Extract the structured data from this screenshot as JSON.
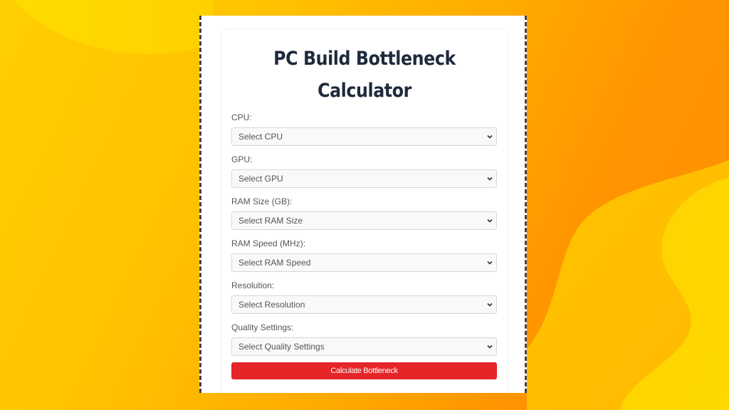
{
  "page": {
    "title": "PC Build Bottleneck Calculator"
  },
  "form": {
    "fields": [
      {
        "label": "CPU:",
        "placeholder": "Select CPU"
      },
      {
        "label": "GPU:",
        "placeholder": "Select GPU"
      },
      {
        "label": "RAM Size (GB):",
        "placeholder": "Select RAM Size"
      },
      {
        "label": "RAM Speed (MHz):",
        "placeholder": "Select RAM Speed"
      },
      {
        "label": "Resolution:",
        "placeholder": "Select Resolution"
      },
      {
        "label": "Quality Settings:",
        "placeholder": "Select Quality Settings"
      }
    ],
    "submit_label": "Calculate Bottleneck"
  },
  "icons": {
    "select_arrow": "chevron-down-icon"
  },
  "colors": {
    "accent_button": "#e52528",
    "title_text": "#1f2a3c",
    "background_yellow": "#ffcf00",
    "background_orange": "#ff8c00"
  }
}
